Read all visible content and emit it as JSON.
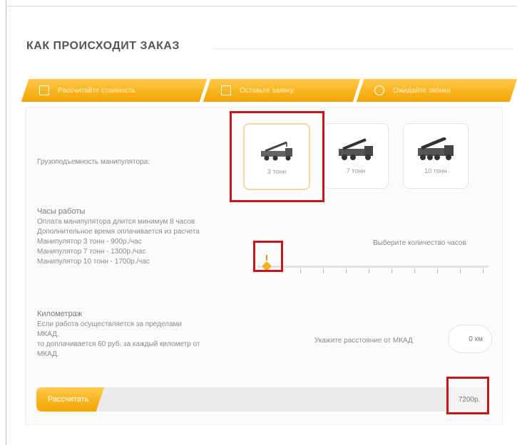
{
  "title": "КАК ПРОИСХОДИТ ЗАКАЗ",
  "steps": [
    {
      "label": "Рассчитайте стоимость",
      "icon": "calculator-icon"
    },
    {
      "label": "Оставьте заявку",
      "icon": "envelope-icon"
    },
    {
      "label": "Ожидайте звонка",
      "icon": "phone-icon"
    }
  ],
  "capacity": {
    "label": "Грузоподъемность манипулятора:",
    "options": [
      {
        "label": "3 тонн",
        "selected": true
      },
      {
        "label": "7 тонн",
        "selected": false
      },
      {
        "label": "10 тонн",
        "selected": false
      }
    ]
  },
  "hours": {
    "title": "Часы работы",
    "lines": [
      "Оплата манипулятора длится минимум 8 часов",
      "Дополнительное время оплачивается из расчета",
      "Манипулятор 3 тонн - 900р./час",
      "Манипулятор 7 тонн - 1300р./час",
      "Манипулятор 10 тонн - 1700р./час"
    ],
    "hint": "Выберите количество часов",
    "slider_value": 0
  },
  "km": {
    "title": "Километраж",
    "lines": [
      "Если работа осуществляется за пределами",
      "МКАД,",
      "то доплачивается 60 руб. за каждый километр от",
      "МКАД."
    ],
    "input_label": "Укажите расстояние от МКАД",
    "input_value": "0 км"
  },
  "calc_button": "Рассчитать",
  "price": "7200р.",
  "colors": {
    "accent": "#f2a400",
    "highlight": "#c8151b"
  }
}
